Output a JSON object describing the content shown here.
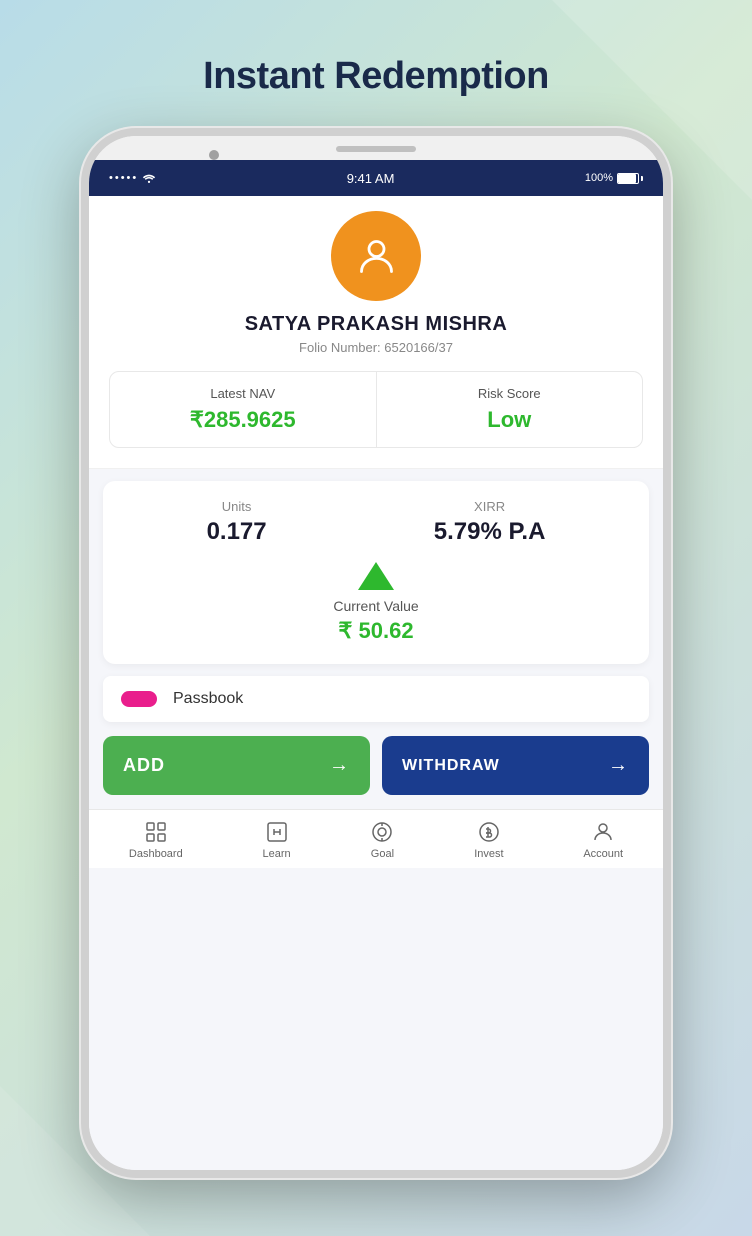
{
  "page": {
    "title": "Instant Redemption",
    "background": "linear-gradient(135deg, #b8dce8 0%, #d0e8d0 40%, #c8d8e8 100%)"
  },
  "status_bar": {
    "signal_dots": "•••••",
    "wifi": "wifi",
    "time": "9:41 AM",
    "battery_percent": "100%"
  },
  "profile": {
    "name": "SATYA PRAKASH MISHRA",
    "folio_label": "Folio Number: 6520166/37"
  },
  "nav_risk": {
    "nav_label": "Latest NAV",
    "nav_value": "₹285.9625",
    "risk_label": "Risk Score",
    "risk_value": "Low"
  },
  "units_xirr": {
    "units_label": "Units",
    "units_value": "0.177",
    "xirr_label": "XIRR",
    "xirr_value": "5.79% P.A"
  },
  "current_value": {
    "label": "Current Value",
    "amount": "₹ 50.62"
  },
  "passbook": {
    "tab_label": "",
    "label": "Passbook"
  },
  "buttons": {
    "add": "ADD",
    "withdraw": "WITHDRAW",
    "arrow": "→"
  },
  "bottom_nav": {
    "items": [
      {
        "label": "Dashboard",
        "icon": "⊞"
      },
      {
        "label": "Learn",
        "icon": "▣"
      },
      {
        "label": "Goal",
        "icon": "◎"
      },
      {
        "label": "Invest",
        "icon": "⊙"
      },
      {
        "label": "Account",
        "icon": "⚬"
      }
    ]
  }
}
